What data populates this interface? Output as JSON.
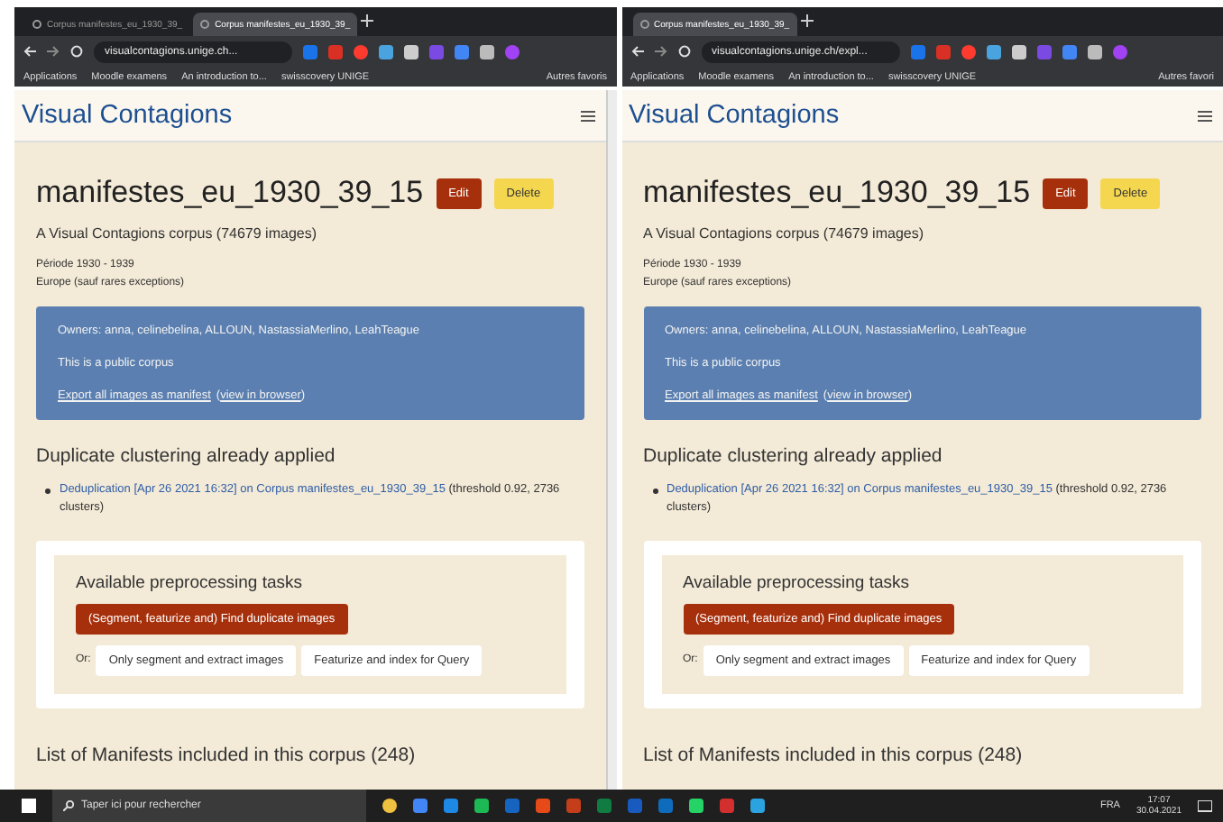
{
  "windows": [
    {
      "tabs": [
        {
          "label": "Corpus manifestes_eu_1930_39_",
          "selected": false
        },
        {
          "label": "Corpus manifestes_eu_1930_39_",
          "selected": true
        }
      ],
      "address": "visualcontagions.unige.ch...",
      "bookmarks": [
        "Applications",
        "Moodle examens",
        "An introduction to...",
        "swisscovery UNIGE"
      ],
      "other_bookmarks": "Autres favoris",
      "scrollbar": true,
      "page": {
        "brand": "Visual Contagions",
        "title": "manifestes_eu_1930_39_15",
        "edit": "Edit",
        "delete": "Delete",
        "subtitle": "A Visual Contagions corpus (74679 images)",
        "period": "Période 1930 - 1939",
        "region": "Europe (sauf rares exceptions)",
        "owners": "Owners: anna, celinebelina, ALLOUN, NastassiaMerlino, LeahTeague",
        "public": "This is a public corpus",
        "export_link": "Export all images as manifest",
        "view_open": "(",
        "view_link": "view in browser",
        "view_close": ")",
        "dup_heading": "Duplicate clustering already applied",
        "dup_link": "Deduplication [Apr 26 2021 16:32] on Corpus manifestes_eu_1930_39_15",
        "dup_rest": " (threshold 0.92, 2736 clusters)",
        "tasks_heading": "Available preprocessing tasks",
        "primary_task": "(Segment, featurize and) Find duplicate images",
        "or": "Or:",
        "tasks": [
          "Only segment and extract images",
          "Featurize and index for Query"
        ],
        "list_heading": "List of Manifests included in this corpus (248)"
      }
    },
    {
      "tabs": [
        {
          "label": "Corpus manifestes_eu_1930_39_",
          "selected": true
        }
      ],
      "address": "visualcontagions.unige.ch/expl...",
      "bookmarks": [
        "Applications",
        "Moodle examens",
        "An introduction to...",
        "swisscovery UNIGE"
      ],
      "other_bookmarks": "Autres favori",
      "scrollbar": false,
      "page": {
        "brand": "Visual Contagions",
        "title": "manifestes_eu_1930_39_15",
        "edit": "Edit",
        "delete": "Delete",
        "subtitle": "A Visual Contagions corpus (74679 images)",
        "period": "Période 1930 - 1939",
        "region": "Europe (sauf rares exceptions)",
        "owners": "Owners: anna, celinebelina, ALLOUN, NastassiaMerlino, LeahTeague",
        "public": "This is a public corpus",
        "export_link": "Export all images as manifest",
        "view_open": "(",
        "view_link": "view in browser",
        "view_close": ")",
        "dup_heading": "Duplicate clustering already applied",
        "dup_link": "Deduplication [Apr 26 2021 16:32] on Corpus manifestes_eu_1930_39_15",
        "dup_rest": " (threshold 0.92, 2736 clusters)",
        "tasks_heading": "Available preprocessing tasks",
        "primary_task": "(Segment, featurize and) Find duplicate images",
        "or": "Or:",
        "tasks": [
          "Only segment and extract images",
          "Featurize and index for Query"
        ],
        "list_heading": "List of Manifests included in this corpus (248)"
      }
    }
  ],
  "taskbar": {
    "search_placeholder": "Taper ici pour rechercher",
    "language": "FRA",
    "time": "17:07",
    "date": "30.04.2021"
  }
}
